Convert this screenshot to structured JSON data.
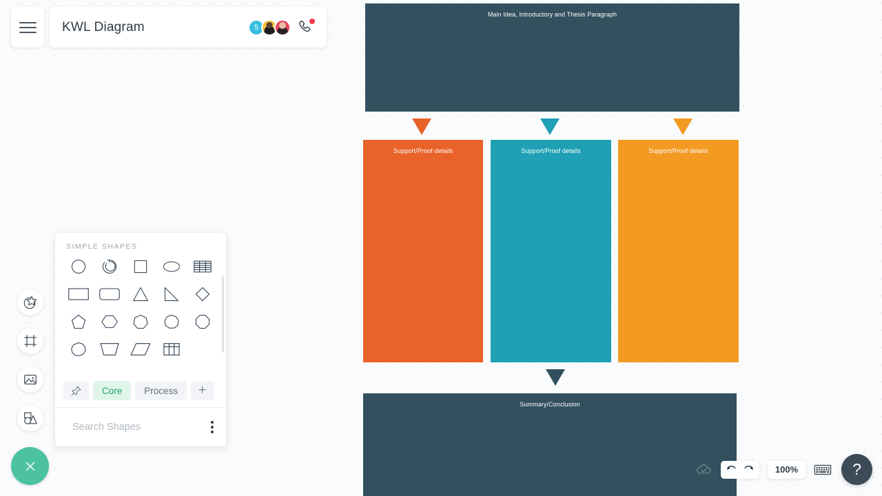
{
  "app": {
    "document_title": "KWL Diagram",
    "menu_icon": "hamburger-menu-icon",
    "call_icon": "phone-call-icon",
    "close_icon": "close-x-icon"
  },
  "collaborators": [
    {
      "name": "shared-count-avatar",
      "initial": "5",
      "color": "#39bfe0"
    },
    {
      "name": "collaborator-avatar-1",
      "initial": "",
      "color": "#f5c142"
    },
    {
      "name": "collaborator-avatar-2",
      "initial": "",
      "color": "#e8455f"
    }
  ],
  "tool_rail": [
    {
      "icon": "shapes-star-icon",
      "label": "Shapes"
    },
    {
      "icon": "frame-icon",
      "label": "Frame"
    },
    {
      "icon": "image-icon",
      "label": "Image"
    },
    {
      "icon": "shape-library-icon",
      "label": "Shape Library"
    }
  ],
  "shapes_panel": {
    "header": "SIMPLE SHAPES",
    "shapes": [
      {
        "icon": "circle-shape-icon",
        "label": "Circle"
      },
      {
        "icon": "arc-shape-icon",
        "label": "Arc"
      },
      {
        "icon": "square-shape-icon",
        "label": "Square"
      },
      {
        "icon": "ellipse-shape-icon",
        "label": "Ellipse"
      },
      {
        "icon": "lined-table-shape-icon",
        "label": "Lined Table"
      },
      {
        "icon": "rectangle-shape-icon",
        "label": "Rectangle"
      },
      {
        "icon": "rounded-rectangle-shape-icon",
        "label": "Rounded Rectangle"
      },
      {
        "icon": "triangle-shape-icon",
        "label": "Triangle"
      },
      {
        "icon": "right-triangle-shape-icon",
        "label": "Right Triangle"
      },
      {
        "icon": "diamond-shape-icon",
        "label": "Diamond"
      },
      {
        "icon": "pentagon-shape-icon",
        "label": "Pentagon"
      },
      {
        "icon": "hexagon-shape-icon",
        "label": "Hexagon"
      },
      {
        "icon": "heptagon-shape-icon",
        "label": "Heptagon"
      },
      {
        "icon": "nonagon-shape-icon",
        "label": "Nonagon"
      },
      {
        "icon": "octagon-shape-icon",
        "label": "Octagon"
      },
      {
        "icon": "decagon-shape-icon",
        "label": "Decagon"
      },
      {
        "icon": "trapezoid-shape-icon",
        "label": "Trapezoid"
      },
      {
        "icon": "parallelogram-shape-icon",
        "label": "Parallelogram"
      },
      {
        "icon": "grid-table-shape-icon",
        "label": "Grid Table"
      }
    ],
    "tabs": [
      {
        "label": "",
        "icon": "pin-icon",
        "active": false,
        "name": "tab-pinned"
      },
      {
        "label": "Core",
        "icon": "",
        "active": true,
        "name": "tab-core"
      },
      {
        "label": "Process",
        "icon": "",
        "active": false,
        "name": "tab-process"
      },
      {
        "label": "+",
        "icon": "plus-icon",
        "active": false,
        "name": "tab-add"
      }
    ],
    "search": {
      "placeholder": "Search Shapes",
      "value": "",
      "icon": "search-icon",
      "more_icon": "kebab-menu-icon"
    }
  },
  "bottom_toolbar": {
    "cloud_icon": "cloud-saved-icon",
    "undo_icon": "undo-icon",
    "redo_icon": "redo-icon",
    "zoom_level": "100%",
    "keyboard_icon": "keyboard-shortcuts-icon",
    "help_label": "?"
  },
  "diagram": {
    "nodes": [
      {
        "name": "main-idea-box",
        "label": "Main Idea, Introductory and Thesis Paragraph",
        "color": "#33505f"
      },
      {
        "name": "support-box-1",
        "label": "Support/Proof details",
        "color": "#e8622a"
      },
      {
        "name": "support-box-2",
        "label": "Support/Proof details",
        "color": "#1fa0b4"
      },
      {
        "name": "support-box-3",
        "label": "Support/Proof details",
        "color": "#f29a22"
      },
      {
        "name": "summary-box",
        "label": "Summary/Conclusion",
        "color": "#33505f"
      }
    ],
    "connectors": [
      {
        "name": "connector-arrow-1",
        "color": "#e8622a"
      },
      {
        "name": "connector-arrow-2",
        "color": "#1fa0b4"
      },
      {
        "name": "connector-arrow-3",
        "color": "#f29a22"
      },
      {
        "name": "connector-arrow-4",
        "color": "#33505f"
      }
    ]
  }
}
